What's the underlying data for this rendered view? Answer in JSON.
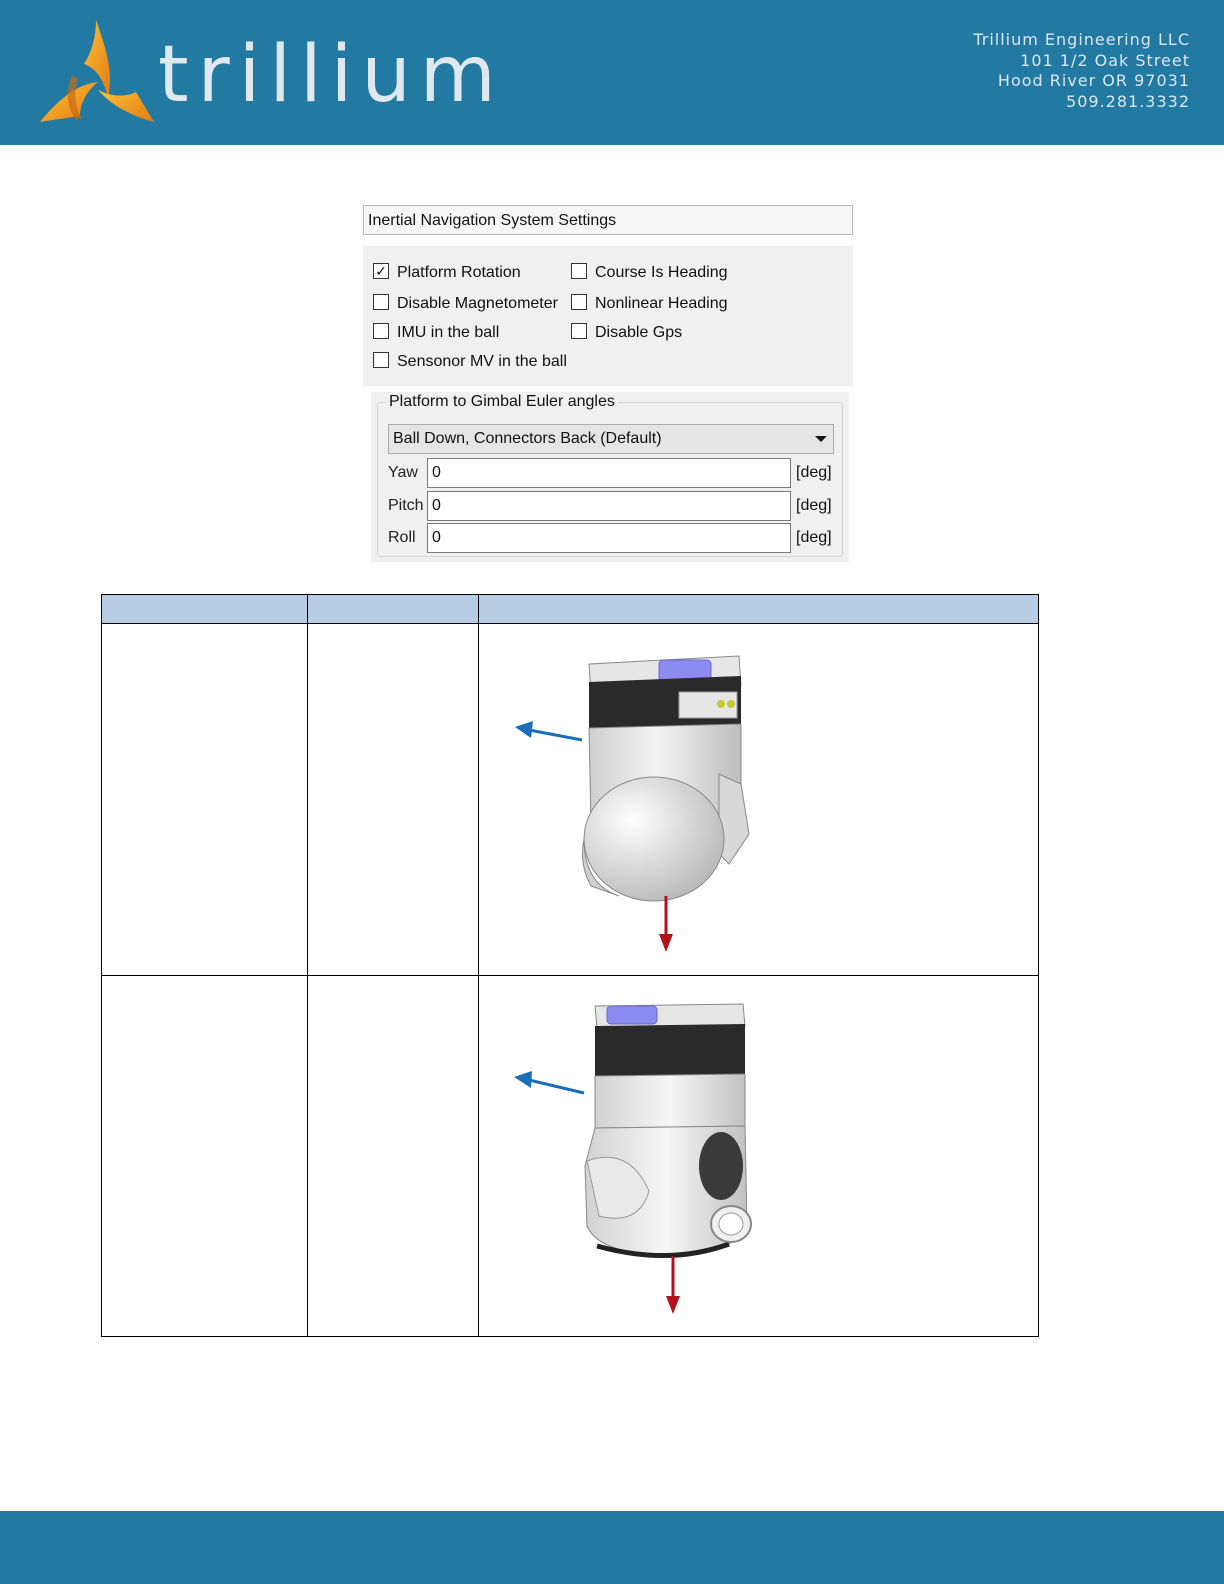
{
  "header": {
    "brand": "trillium",
    "address_lines": [
      "Trillium Engineering LLC",
      "101 1/2 Oak Street",
      "Hood River OR 97031",
      "509.281.3332"
    ]
  },
  "settings": {
    "title": "Inertial Navigation System Settings",
    "checkboxes": [
      {
        "label": "Platform Rotation",
        "checked": true
      },
      {
        "label": "Course Is Heading",
        "checked": false
      },
      {
        "label": "Disable Magnetometer",
        "checked": false
      },
      {
        "label": "Nonlinear Heading",
        "checked": false
      },
      {
        "label": "IMU in the ball",
        "checked": false
      },
      {
        "label": "Disable Gps",
        "checked": false
      },
      {
        "label": "Sensonor MV in the ball",
        "checked": false
      }
    ],
    "checkmark": "✓",
    "group_title": "Platform to Gimbal Euler angles",
    "dropdown_value": "Ball Down, Connectors Back (Default)",
    "fields": [
      {
        "label": "Yaw",
        "value": "0",
        "unit": "[deg]"
      },
      {
        "label": "Pitch",
        "value": "0",
        "unit": "[deg]"
      },
      {
        "label": "Roll",
        "value": "0",
        "unit": "[deg]"
      }
    ]
  },
  "colors": {
    "header_bg": "#2279a1",
    "table_header_bg": "#b8cce4",
    "forward_arrow": "#1a6fb8",
    "down_arrow": "#b3121c",
    "accent_logo": "#f0a020"
  }
}
